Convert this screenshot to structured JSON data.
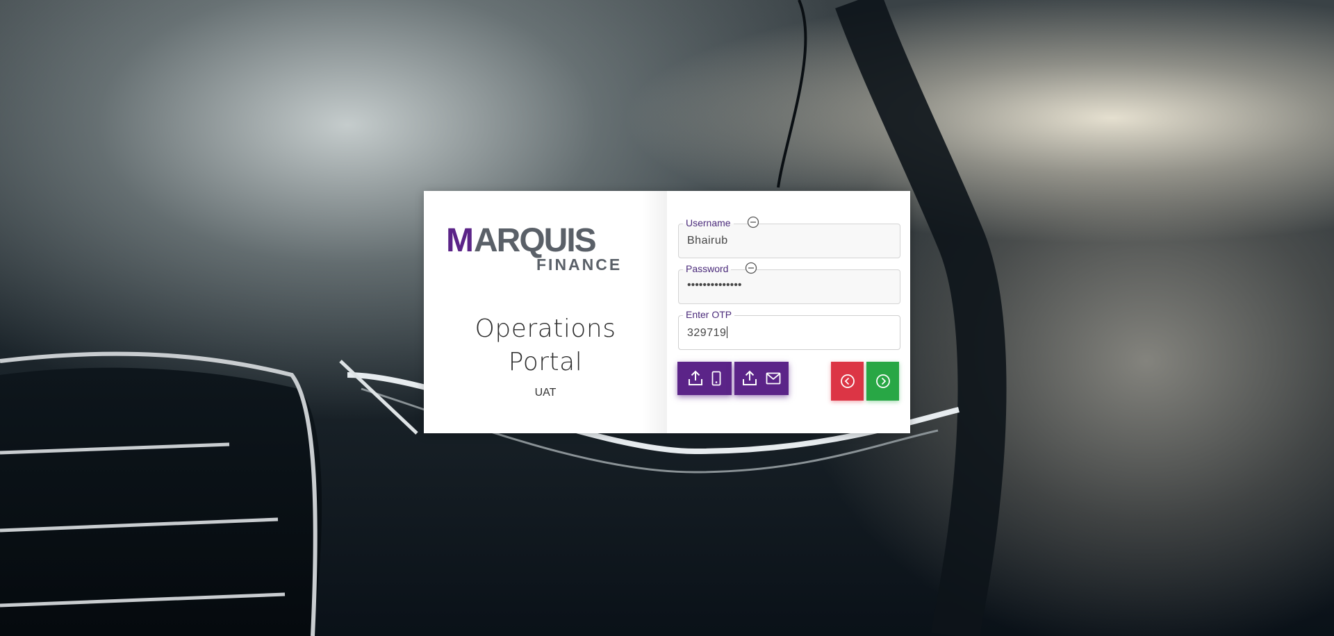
{
  "brand": {
    "logo_primary": "MARQUIS",
    "logo_secondary": "FINANCE",
    "colors": {
      "purple": "#5b2488",
      "gray": "#5a6068"
    }
  },
  "portal": {
    "title_line1": "Operations",
    "title_line2": "Portal",
    "environment": "UAT"
  },
  "form": {
    "username": {
      "label": "Username",
      "value": "Bhairub",
      "icon": "minus-circle-icon"
    },
    "password": {
      "label": "Password",
      "value": "••••••••••••••",
      "icon": "minus-circle-icon"
    },
    "otp": {
      "label": "Enter OTP",
      "value": "329719"
    }
  },
  "actions": {
    "send_sms": {
      "icons": [
        "upload-icon",
        "phone-icon"
      ],
      "color": "#5b2488"
    },
    "send_email": {
      "icons": [
        "upload-icon",
        "mail-icon"
      ],
      "color": "#5b2488"
    },
    "back": {
      "icon": "chevron-left-circle-icon",
      "color": "#dc3545"
    },
    "next": {
      "icon": "chevron-right-circle-icon",
      "color": "#28a745"
    }
  }
}
